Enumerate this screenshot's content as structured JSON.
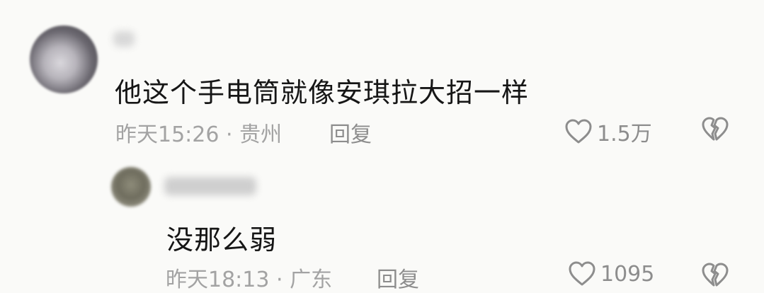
{
  "comments": [
    {
      "text": "他这个手电筒就像安琪拉大招一样",
      "meta": "昨天15:26 · 贵州",
      "reply_label": "回复",
      "likes": "1.5万"
    },
    {
      "text": "没那么弱",
      "meta": "昨天18:13 · 广东",
      "reply_label": "回复",
      "likes": "1095"
    }
  ],
  "icons": {
    "like": "heart-outline-icon",
    "dislike": "broken-heart-icon"
  },
  "colors": {
    "background": "#fafaf8",
    "text": "#161616",
    "meta": "#a3a3a3",
    "icon": "#8d8d8d"
  }
}
